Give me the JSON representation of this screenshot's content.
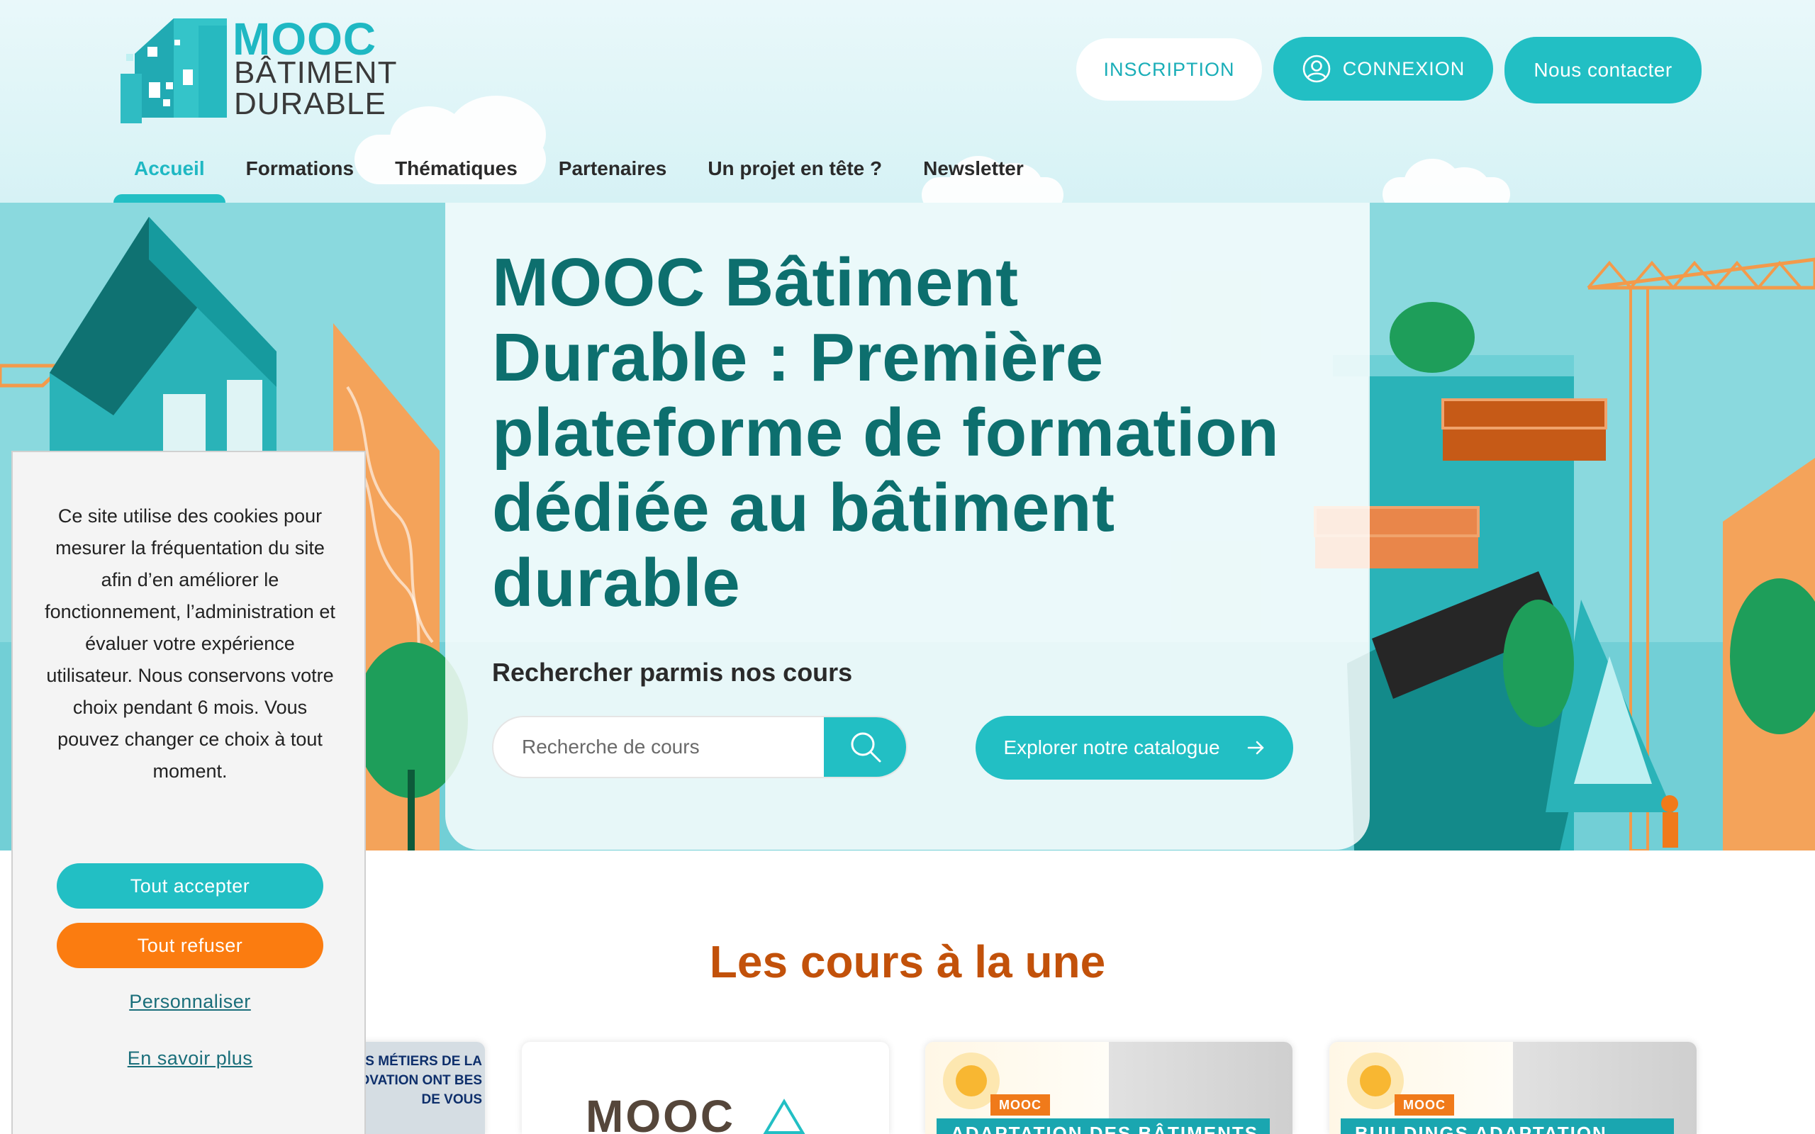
{
  "brand": {
    "line1": "MOOC",
    "line2": "BÂTIMENT",
    "line3": "DURABLE"
  },
  "header": {
    "inscription_label": "INSCRIPTION",
    "connexion_label": "CONNEXION",
    "contact_label": "Nous contacter"
  },
  "nav": {
    "items": [
      {
        "label": "Accueil"
      },
      {
        "label": "Formations"
      },
      {
        "label": "Thématiques"
      },
      {
        "label": "Partenaires"
      },
      {
        "label": "Un projet en tête ?"
      },
      {
        "label": "Newsletter"
      }
    ],
    "active": "Accueil"
  },
  "hero": {
    "title": "MOOC Bâtiment Durable : Première plateforme de formation dédiée au bâtiment durable",
    "search_label": "Rechercher parmis nos cours",
    "search_placeholder": "Recherche de cours",
    "catalog_label": "Explorer notre catalogue"
  },
  "featured": {
    "title": "Les cours à la une",
    "cards": [
      {
        "lines": [
          "LES MÉTIERS DE LA",
          "OVATION ONT BES",
          "DE VOUS"
        ]
      },
      {
        "word": "MOOC"
      },
      {
        "tag": "MOOC",
        "band": "ADAPTATION DES BÂTIMENTS"
      },
      {
        "tag": "MOOC",
        "band": "BUILDINGS ADAPTATION"
      }
    ]
  },
  "cookie": {
    "text": "Ce site utilise des cookies pour mesurer la fréquentation du site afin d’en améliorer le fonctionnement, l’administration et évaluer votre expérience utilisateur. Nous conservons votre choix pendant 6 mois. Vous pouvez changer ce choix à tout moment.",
    "accept_label": "Tout accepter",
    "refuse_label": "Tout refuser",
    "customize_label": "Personnaliser",
    "more_label": "En savoir plus"
  },
  "colors": {
    "accent": "#22bfc4",
    "title_teal": "#0d6f6e",
    "orange": "#fb7c10",
    "featured_title": "#c2510a"
  },
  "icons": {
    "connexion": "user-icon",
    "search": "search-icon",
    "catalog": "arrow-right-icon"
  }
}
